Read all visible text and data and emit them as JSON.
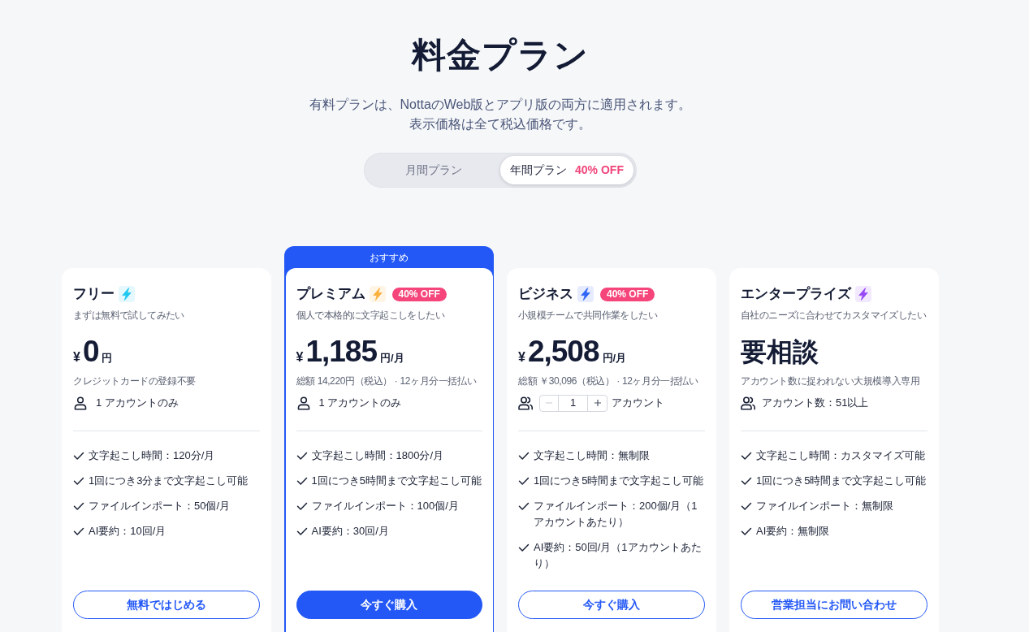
{
  "title": "料金プラン",
  "subtitle_lines": [
    "有料プランは、NottaのWeb版とアプリ版の両方に適用されます。",
    "表示価格は全て税込価格です。"
  ],
  "billing_tabs": [
    {
      "label": "月間プラン",
      "selected": false
    },
    {
      "label": "年間プラン",
      "badge": "40% OFF",
      "selected": true
    }
  ],
  "plans": [
    {
      "name": "フリー",
      "color": "#1fc8ef",
      "tagline": "まずは無料で試してみたい",
      "price": {
        "kind": "amount",
        "currency": "¥",
        "amount": "0",
        "unit": "円"
      },
      "note": "クレジットカードの登録不要",
      "account": {
        "kind": "single",
        "text": "1 アカウントのみ"
      },
      "features": [
        "文字起こし時間：120分/月",
        "1回につき3分まで文字起こし可能",
        "ファイルインポート：50個/月",
        "AI要約：10回/月"
      ],
      "button": {
        "label": "無料ではじめる",
        "primary": false
      }
    },
    {
      "ribbon": "おすすめ",
      "name": "プレミアム",
      "color": "#fbb03b",
      "badge": "40% OFF",
      "tagline": "個人で本格的に文字起こしをしたい",
      "price": {
        "kind": "amount",
        "currency": "¥",
        "amount": "1,185",
        "unit": "円/月"
      },
      "note": "総額 14,220円（税込） · 12ヶ月分一括払い",
      "account": {
        "kind": "single",
        "text": "1 アカウントのみ"
      },
      "features": [
        "文字起こし時間：1800分/月",
        "1回につき5時間まで文字起こし可能",
        "ファイルインポート：100個/月",
        "AI要約：30回/月"
      ],
      "button": {
        "label": "今すぐ購入",
        "primary": true
      }
    },
    {
      "name": "ビジネス",
      "color": "#2f66f6",
      "badge": "40% OFF",
      "tagline": "小規模チームで共同作業をしたい",
      "price": {
        "kind": "amount",
        "currency": "¥",
        "amount": "2,508",
        "unit": "円/月"
      },
      "note": "総額 ￥30,096（税込） · 12ヶ月分一括払い",
      "account": {
        "kind": "stepper",
        "value": "1",
        "minus_disabled": true,
        "unit": "アカウント"
      },
      "features": [
        "文字起こし時間：無制限",
        "1回につき5時間まで文字起こし可能",
        "ファイルインポート：200個/月（1アカウントあたり）",
        "AI要約：50回/月（1アカウントあたり）"
      ],
      "button": {
        "label": "今すぐ購入",
        "primary": false
      }
    },
    {
      "name": "エンタープライズ",
      "color": "#9747f5",
      "tagline": "自社のニーズに合わせてカスタマイズしたい",
      "price": {
        "kind": "text",
        "text": "要相談"
      },
      "note": "アカウント数に捉われない大規模導入専用",
      "account": {
        "kind": "team",
        "text": "アカウント数：51以上"
      },
      "features": [
        "文字起こし時間：カスタマイズ可能",
        "1回につき5時間まで文字起こし可能",
        "ファイルインポート：無制限",
        "AI要約：無制限"
      ],
      "button": {
        "label": "営業担当にお問い合わせ",
        "primary": false
      }
    }
  ]
}
